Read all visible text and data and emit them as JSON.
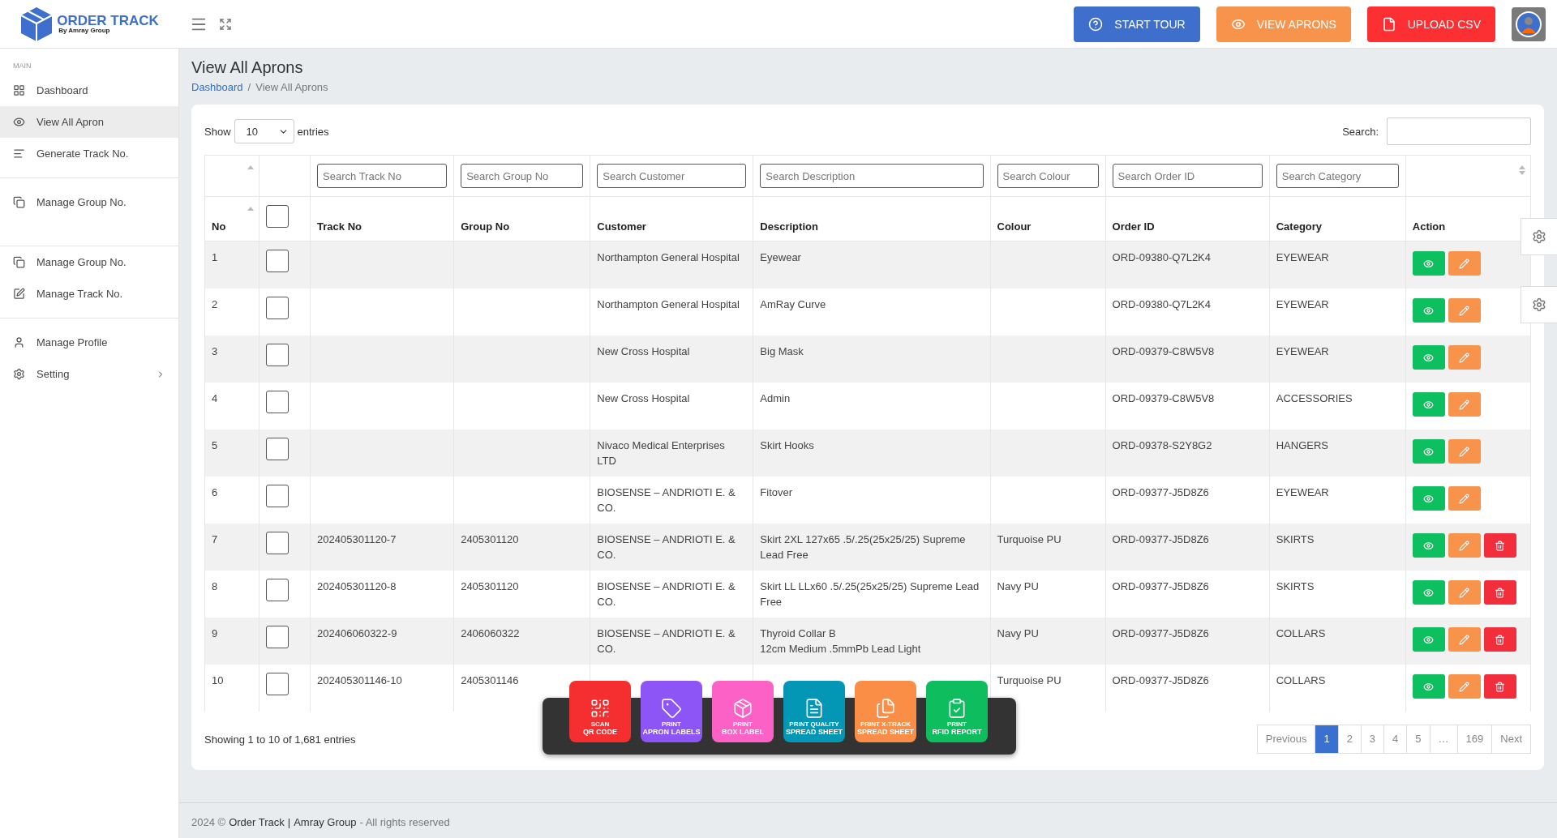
{
  "brand": {
    "name": "ORDER TRACK",
    "tagline": "By Amray Group"
  },
  "header_buttons": [
    {
      "label": "START TOUR",
      "kind": "tour"
    },
    {
      "label": "VIEW APRONS",
      "kind": "view"
    },
    {
      "label": "UPLOAD CSV",
      "kind": "upload"
    }
  ],
  "sidebar": {
    "section_label": "MAIN",
    "groups": [
      [
        {
          "label": "Dashboard",
          "selected": false
        },
        {
          "label": "View All Apron",
          "selected": true
        },
        {
          "label": "Generate Track No.",
          "selected": false
        }
      ],
      [
        {
          "label": "Manage Group No.",
          "selected": false
        }
      ],
      [
        {
          "label": "Manage Group No.",
          "selected": false
        },
        {
          "label": "Manage Track No.",
          "selected": false
        }
      ],
      [
        {
          "label": "Manage Profile",
          "selected": false
        },
        {
          "label": "Setting",
          "selected": false,
          "expanded": false
        }
      ]
    ]
  },
  "page": {
    "title": "View All Aprons",
    "breadcrumb": [
      {
        "label": "Dashboard",
        "link": true
      },
      {
        "label": "View All Aprons",
        "link": false
      }
    ],
    "breadcrumb_separator": "/"
  },
  "table_controls": {
    "show_label": "Show",
    "page_size": "10",
    "entries_label": "entries",
    "search_label": "Search:"
  },
  "table": {
    "filters": [
      {
        "placeholder": "Search Track No"
      },
      {
        "placeholder": "Search Group No"
      },
      {
        "placeholder": "Search Customer"
      },
      {
        "placeholder": "Search Description"
      },
      {
        "placeholder": "Search Colour"
      },
      {
        "placeholder": "Search Order ID"
      },
      {
        "placeholder": "Search Category"
      }
    ],
    "columns": [
      "No",
      "",
      "Track No",
      "Group No",
      "Customer",
      "Description",
      "Colour",
      "Order ID",
      "Category",
      "Action"
    ],
    "header_checked": false,
    "rows": [
      {
        "checked": false,
        "cells": [
          "1",
          "",
          "",
          "",
          "Northampton General Hospital",
          "Eyewear",
          "",
          "ORD-09380-Q7L2K4",
          "EYEWEAR"
        ],
        "actions": [
          {
            "kind": "view"
          },
          {
            "kind": "edit"
          }
        ]
      },
      {
        "checked": false,
        "cells": [
          "2",
          "",
          "",
          "",
          "Northampton General Hospital",
          "AmRay Curve",
          "",
          "ORD-09380-Q7L2K4",
          "EYEWEAR"
        ],
        "actions": [
          {
            "kind": "view"
          },
          {
            "kind": "edit"
          }
        ]
      },
      {
        "checked": false,
        "cells": [
          "3",
          "",
          "",
          "",
          "New Cross Hospital",
          "Big Mask",
          "",
          "ORD-09379-C8W5V8",
          "EYEWEAR"
        ],
        "actions": [
          {
            "kind": "view"
          },
          {
            "kind": "edit"
          }
        ]
      },
      {
        "checked": false,
        "cells": [
          "4",
          "",
          "",
          "",
          "New Cross Hospital",
          "Admin",
          "",
          "ORD-09379-C8W5V8",
          "ACCESSORIES"
        ],
        "actions": [
          {
            "kind": "view"
          },
          {
            "kind": "edit"
          }
        ]
      },
      {
        "checked": false,
        "cells": [
          "5",
          "",
          "",
          "",
          "Nivaco Medical Enterprises LTD",
          "Skirt Hooks",
          "",
          "ORD-09378-S2Y8G2",
          "HANGERS"
        ],
        "actions": [
          {
            "kind": "view"
          },
          {
            "kind": "edit"
          }
        ]
      },
      {
        "checked": false,
        "cells": [
          "6",
          "",
          "",
          "",
          "BIOSENSE – ANDRIOTI E. & CO.",
          "Fitover",
          "",
          "ORD-09377-J5D8Z6",
          "EYEWEAR"
        ],
        "actions": [
          {
            "kind": "view"
          },
          {
            "kind": "edit"
          }
        ]
      },
      {
        "checked": false,
        "cells": [
          "7",
          "",
          "202405301120-7",
          "2405301120",
          "BIOSENSE – ANDRIOTI E. & CO.",
          "Skirt 2XL 127x65 .5/.25(25x25/25) Supreme Lead Free",
          "Turquoise PU",
          "ORD-09377-J5D8Z6",
          "SKIRTS"
        ],
        "actions": [
          {
            "kind": "view"
          },
          {
            "kind": "edit"
          },
          {
            "kind": "delete"
          }
        ]
      },
      {
        "checked": false,
        "cells": [
          "8",
          "",
          "202405301120-8",
          "2405301120",
          "BIOSENSE – ANDRIOTI E. & CO.",
          "Skirt LL LLx60 .5/.25(25x25/25) Supreme Lead Free",
          "Navy PU",
          "ORD-09377-J5D8Z6",
          "SKIRTS"
        ],
        "actions": [
          {
            "kind": "view"
          },
          {
            "kind": "edit"
          },
          {
            "kind": "delete"
          }
        ]
      },
      {
        "checked": false,
        "cells": [
          "9",
          "",
          "202406060322-9",
          "2406060322",
          "BIOSENSE – ANDRIOTI E. & CO.",
          "Thyroid Collar B\n12cm Medium .5mmPb Lead Light",
          "Navy PU",
          "ORD-09377-J5D8Z6",
          "COLLARS"
        ],
        "actions": [
          {
            "kind": "view"
          },
          {
            "kind": "edit"
          },
          {
            "kind": "delete"
          }
        ]
      },
      {
        "checked": false,
        "cells": [
          "10",
          "",
          "202405301146-10",
          "2405301146",
          "",
          "",
          "Turquoise PU",
          "ORD-09377-J5D8Z6",
          "COLLARS"
        ],
        "actions": [
          {
            "kind": "view"
          },
          {
            "kind": "edit"
          },
          {
            "kind": "delete"
          }
        ]
      }
    ]
  },
  "info": "Showing 1 to 10 of 1,681 entries",
  "pagination": [
    {
      "label": "Previous",
      "selected": false
    },
    {
      "label": "1",
      "selected": true
    },
    {
      "label": "2",
      "selected": false
    },
    {
      "label": "3",
      "selected": false
    },
    {
      "label": "4",
      "selected": false
    },
    {
      "label": "5",
      "selected": false
    },
    {
      "label": "…",
      "selected": false
    },
    {
      "label": "169",
      "selected": false
    },
    {
      "label": "Next",
      "selected": false
    }
  ],
  "tools": [
    {
      "caption": "SCAN",
      "label": "QR CODE",
      "color": "#f52f2f",
      "kind": "qr"
    },
    {
      "caption": "PRINT",
      "label": "APRON LABELS",
      "color": "#8d55f5",
      "kind": "tag"
    },
    {
      "caption": "PRINT",
      "label": "BOX LABEL",
      "color": "#fc62c5",
      "kind": "box"
    },
    {
      "caption": "PRINT QUALITY",
      "label": "SPREAD SHEET",
      "color": "#0497b5",
      "kind": "sheet"
    },
    {
      "caption": "PRINT X-TRACK",
      "label": "SPREAD SHEET",
      "color": "#fa8e47",
      "kind": "files"
    },
    {
      "caption": "PRINT",
      "label": "RFID REPORT",
      "color": "#0dbd5e",
      "kind": "clipboard"
    }
  ],
  "footer": [
    {
      "text": "2024 ©",
      "link": false
    },
    {
      "text": "Order Track",
      "link": true
    },
    {
      "text": "|",
      "link": true
    },
    {
      "text": "Amray Group",
      "link": true
    },
    {
      "text": "- All rights reserved",
      "link": false
    }
  ]
}
